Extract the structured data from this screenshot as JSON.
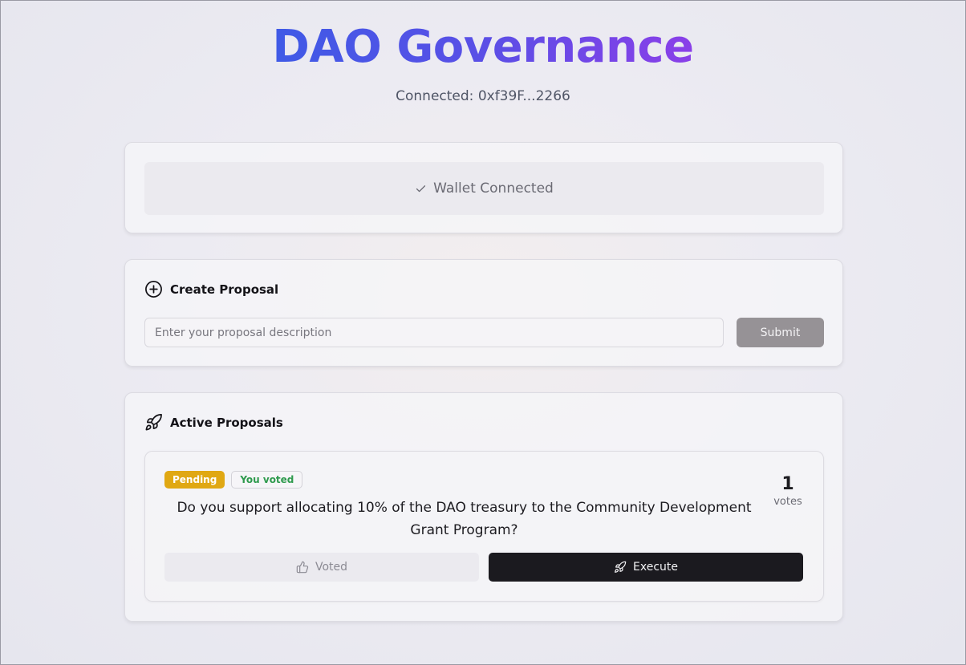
{
  "header": {
    "title": "DAO Governance",
    "connected": "Connected: 0xf39F...2266"
  },
  "wallet": {
    "status": "Wallet Connected",
    "icon": "check-icon"
  },
  "create_proposal": {
    "heading": "Create Proposal",
    "icon": "plus-circle-icon",
    "input_placeholder": "Enter your proposal description",
    "input_value": "",
    "submit_label": "Submit"
  },
  "active_proposals": {
    "heading": "Active Proposals",
    "icon": "rocket-icon",
    "items": [
      {
        "status_badge": "Pending",
        "voted_badge": "You voted",
        "description": "Do you support allocating 10% of the DAO treasury to the Community Development Grant Program?",
        "votes": "1",
        "votes_label": "votes",
        "voted_button": "Voted",
        "execute_button": "Execute"
      }
    ]
  },
  "colors": {
    "title_gradient_start": "#3f5ae6",
    "title_gradient_end": "#8a3fe8",
    "pending": "#e0a813",
    "voted_text": "#2e9a4d",
    "execute_bg": "#1b1a1f"
  }
}
